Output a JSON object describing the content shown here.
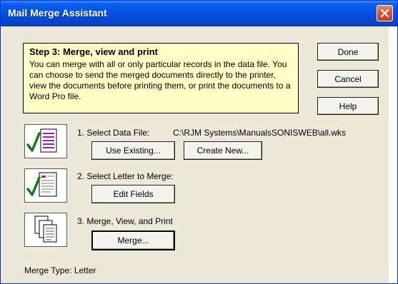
{
  "window": {
    "title": "Mail Merge Assistant"
  },
  "info": {
    "step_title": "Step 3: Merge, view and print",
    "description": "You can merge with all or only particular records in the data file.  You can choose to send the merged documents directly to the printer, view the documents before printing them, or print the documents to a Word Pro file."
  },
  "side_buttons": {
    "done": "Done",
    "cancel": "Cancel",
    "help": "Help"
  },
  "step1": {
    "label": "1. Select Data File:",
    "path": "C:\\RJM Systems\\ManualsSONISWEB\\all.wks",
    "use_existing": "Use Existing...",
    "create_new": "Create New..."
  },
  "step2": {
    "label": "2. Select Letter to Merge:",
    "edit_fields": "Edit Fields"
  },
  "step3": {
    "label": "3. Merge, View, and Print",
    "merge": "Merge..."
  },
  "merge_type": "Merge Type:  Letter",
  "colors": {
    "title_bar": "#0453e0",
    "info_bg": "#ffffc6",
    "checkmark": "#1a7a1a",
    "list_accent": "#9b1fa8"
  },
  "icons": {
    "close": "close-icon",
    "data_file": "data-file-check-icon",
    "letter": "letter-check-icon",
    "merge_docs": "stacked-documents-icon"
  }
}
